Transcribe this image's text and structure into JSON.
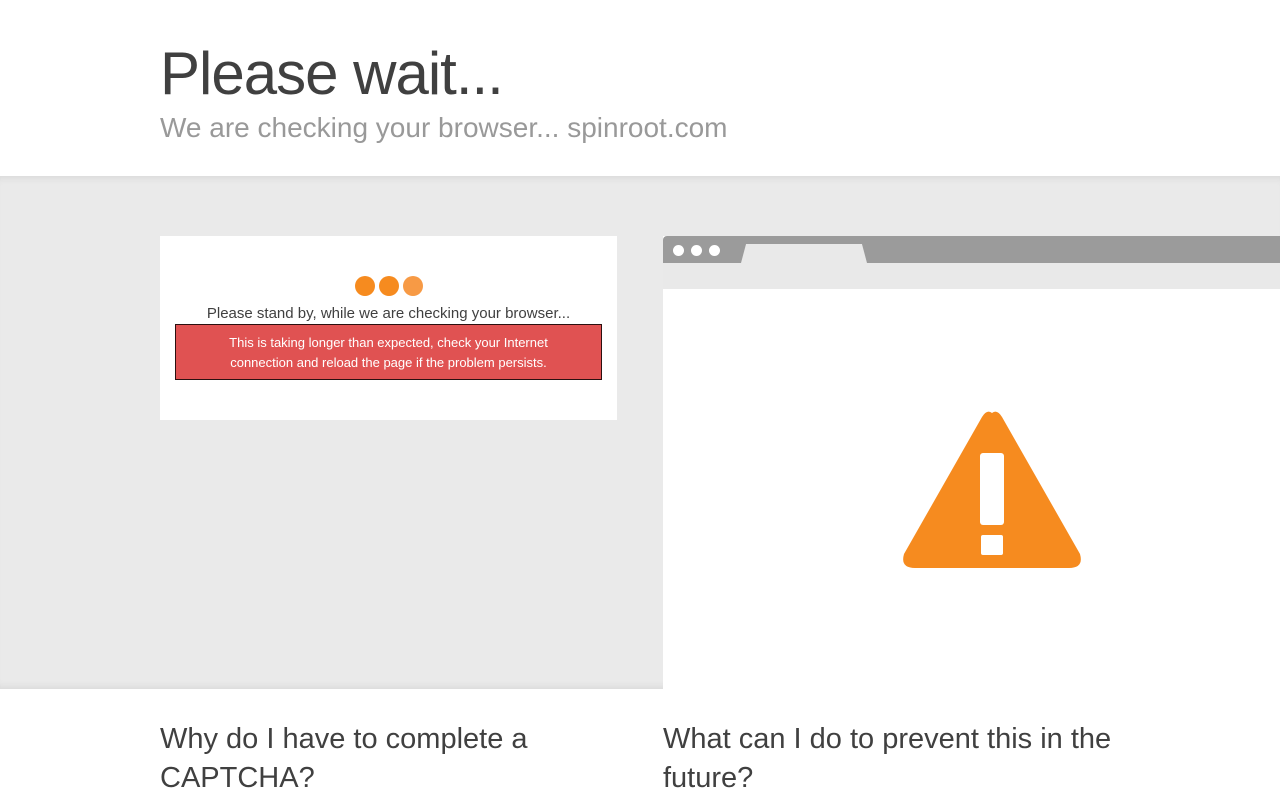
{
  "header": {
    "title": "Please wait...",
    "subtitle": "We are checking your browser... spinroot.com"
  },
  "challenge": {
    "status_text": "Please stand by, while we are checking your browser...",
    "error_line1": "This is taking longer than expected, check your Internet",
    "error_line2": "connection and reload the page if the problem persists."
  },
  "faq": {
    "why_title": "Why do I have to complete a CAPTCHA?",
    "prevent_title": "What can I do to prevent this in the future?"
  },
  "colors": {
    "accent_orange": "#f68b1f",
    "error_red": "#e05252",
    "band_gray": "#eaeaea",
    "browser_bar": "#9b9b9b"
  },
  "icons": {
    "loading": "loading-dots-icon",
    "warning": "warning-triangle-icon"
  }
}
